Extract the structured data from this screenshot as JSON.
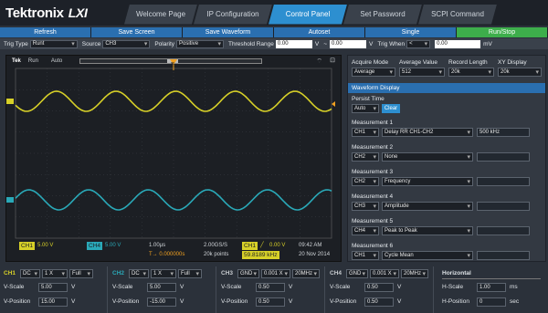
{
  "brand": {
    "name": "Tektronix",
    "suffix": "LXI"
  },
  "nav": {
    "tabs": [
      {
        "label": "Welcome Page"
      },
      {
        "label": "IP Configuration"
      },
      {
        "label": "Control Panel",
        "active": true
      },
      {
        "label": "Set Password"
      },
      {
        "label": "SCPI Command"
      }
    ]
  },
  "actions": [
    "Refresh",
    "Save Screen",
    "Save Waveform",
    "Autoset",
    "Single",
    "Run/Stop"
  ],
  "trigger": {
    "type_label": "Trig Type",
    "type_value": "Runt",
    "source_label": "Source",
    "source_value": "CH3",
    "polarity_label": "Polarity",
    "polarity_value": "Positive",
    "range_label": "Threshold Range",
    "range_low": "0.00",
    "range_low_unit": "V",
    "range_sep": "~",
    "range_high": "0.00",
    "range_high_unit": "V",
    "when_label": "Trig When",
    "when_value": "<",
    "when_input": "0.00",
    "when_unit": "mV"
  },
  "scope": {
    "status_brand": "Tek",
    "status_run": "Run",
    "status_mode": "Auto",
    "marker_t": "T",
    "ch1_badge": "CH1",
    "ch1_scale": "5.00 V",
    "ch4_badge": "CH4",
    "ch4_scale": "5.00 V",
    "timebase": "1.00µs",
    "delay": "T→ 0.000000s",
    "sample_rate": "2.00GS/S",
    "points": "20k points",
    "trig_badge": "CH1",
    "trig_slope": "╱",
    "trig_level": "0.00 V",
    "freq": "59.8189 kHz",
    "time": "09:42 AM",
    "date": "20 Nov 2014",
    "colors": {
      "ch1": "#d7d028",
      "ch4": "#2aa9b8",
      "trigger": "#f0a020"
    }
  },
  "panel": {
    "acq_label": "Acquire Mode",
    "acq_value": "Average",
    "avg_label": "Average Value",
    "avg_value": "512",
    "len_label": "Record Length",
    "len_value": "20k",
    "xy_label": "XY Display",
    "xy_value": "20k",
    "waveform_header": "Waveform Display",
    "persist_label": "Persist Time",
    "persist_value": "Auto",
    "clear_button": "Clear",
    "measurements": [
      {
        "label": "Measurement 1",
        "src": "CH1",
        "type": "Delay RR CH1-CH2",
        "value": "500 kHz"
      },
      {
        "label": "Measurement 2",
        "src": "CH2",
        "type": "None",
        "value": ""
      },
      {
        "label": "Measurement 3",
        "src": "CH2",
        "type": "Frequency",
        "value": ""
      },
      {
        "label": "Measurement 4",
        "src": "CH3",
        "type": "Amplitude",
        "value": ""
      },
      {
        "label": "Measurement 5",
        "src": "CH4",
        "type": "Peak to Peak",
        "value": ""
      },
      {
        "label": "Measurement 6",
        "src": "CH1",
        "type": "Cycle Mean",
        "value": ""
      }
    ]
  },
  "channels": [
    {
      "name": "CH1",
      "coupling": "DC",
      "probe": "1 X",
      "bw": "Full",
      "vscale_label": "V-Scale",
      "vscale": "5.00",
      "vpos_label": "V-Position",
      "vpos": "15.00",
      "unit": "V",
      "color": "#d7d028"
    },
    {
      "name": "CH2",
      "coupling": "DC",
      "probe": "1 X",
      "bw": "Full",
      "vscale_label": "V-Scale",
      "vscale": "5.00",
      "vpos_label": "V-Position",
      "vpos": "-15.00",
      "unit": "V",
      "color": "#2aa9b8"
    },
    {
      "name": "CH3",
      "coupling": "GND",
      "probe": "0.001 X",
      "bw": "20MHz",
      "vscale_label": "V-Scale",
      "vscale": "0.50",
      "vpos_label": "V-Position",
      "vpos": "0.50",
      "unit": "V",
      "color": "#c8ccd0"
    },
    {
      "name": "CH4",
      "coupling": "GND",
      "probe": "0.001 X",
      "bw": "20MHz",
      "vscale_label": "V-Scale",
      "vscale": "0.50",
      "vpos_label": "V-Position",
      "vpos": "0.50",
      "unit": "V",
      "color": "#c8ccd0"
    }
  ],
  "horizontal": {
    "label": "Horizontal",
    "hscale_label": "H-Scale",
    "hscale": "1.00",
    "hscale_unit": "ms",
    "hpos_label": "H-Position",
    "hpos": "0",
    "hpos_unit": "sec"
  }
}
